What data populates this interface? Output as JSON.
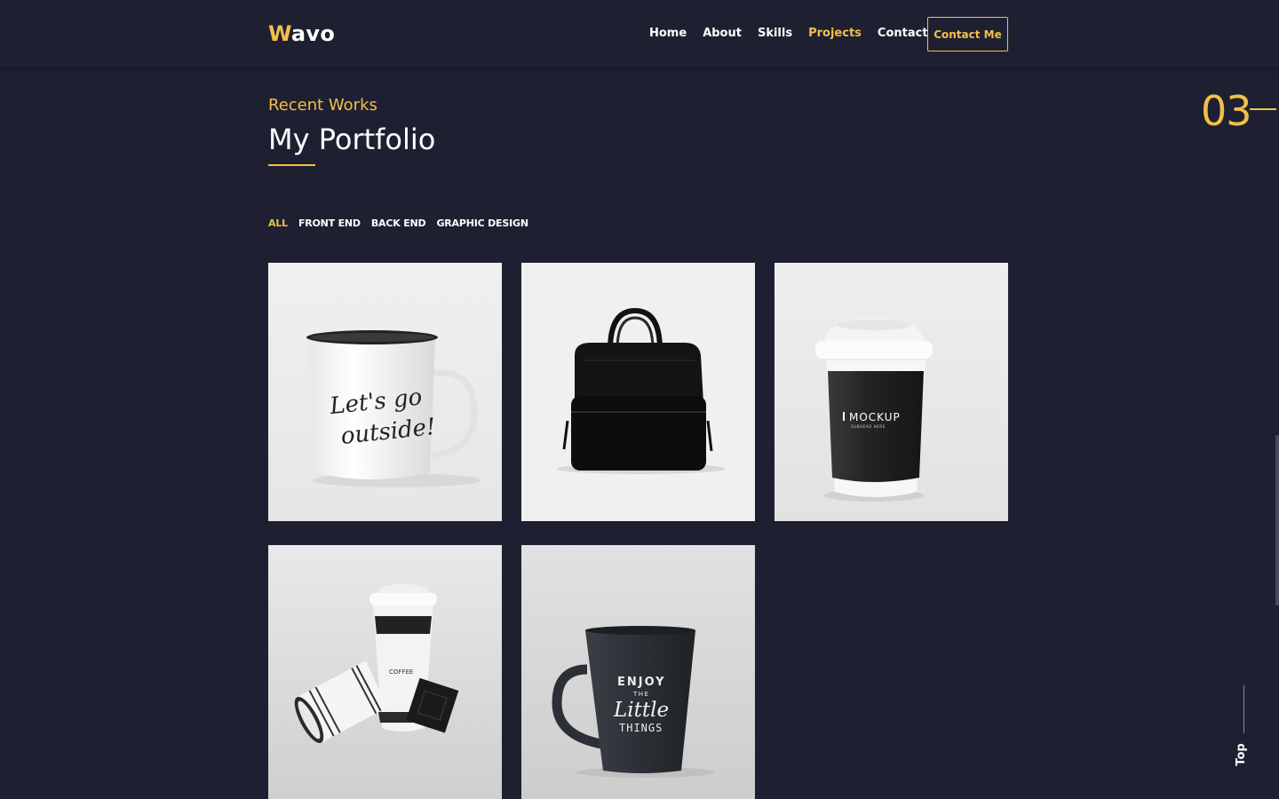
{
  "header": {
    "logo": {
      "first_letter": "W",
      "rest": "avo"
    },
    "nav": [
      {
        "label": "Home"
      },
      {
        "label": "About"
      },
      {
        "label": "Skills"
      },
      {
        "label": "Projects",
        "active": true
      },
      {
        "label": "Contact"
      }
    ],
    "cta_label": "Contact Me"
  },
  "section": {
    "number": "03",
    "subtitle": "Recent Works",
    "title": "My Portfolio"
  },
  "filters": [
    {
      "label": "ALL",
      "active": true
    },
    {
      "label": "FRONT END"
    },
    {
      "label": "BACK END"
    },
    {
      "label": "GRAPHIC DESIGN"
    }
  ],
  "portfolio": {
    "items": [
      {
        "image": "enamel-mug",
        "mug_text_line1": "Let's go",
        "mug_text_line2": "outside!"
      },
      {
        "image": "black-backpack"
      },
      {
        "image": "coffee-cup-mockup",
        "cup_text": "MOCKUP",
        "cup_subtext": "SUBHEAD HERE"
      },
      {
        "image": "coffee-cups-set",
        "cup_text": "COFFEE"
      },
      {
        "image": "dark-mug",
        "mug_text_line1": "ENJOY",
        "mug_text_line2": "THE",
        "mug_text_line3": "Little",
        "mug_text_line4": "THINGS"
      }
    ]
  },
  "back_to_top": "Top",
  "colors": {
    "background": "#1e2032",
    "accent": "#f3bf47",
    "text": "#ffffff"
  }
}
